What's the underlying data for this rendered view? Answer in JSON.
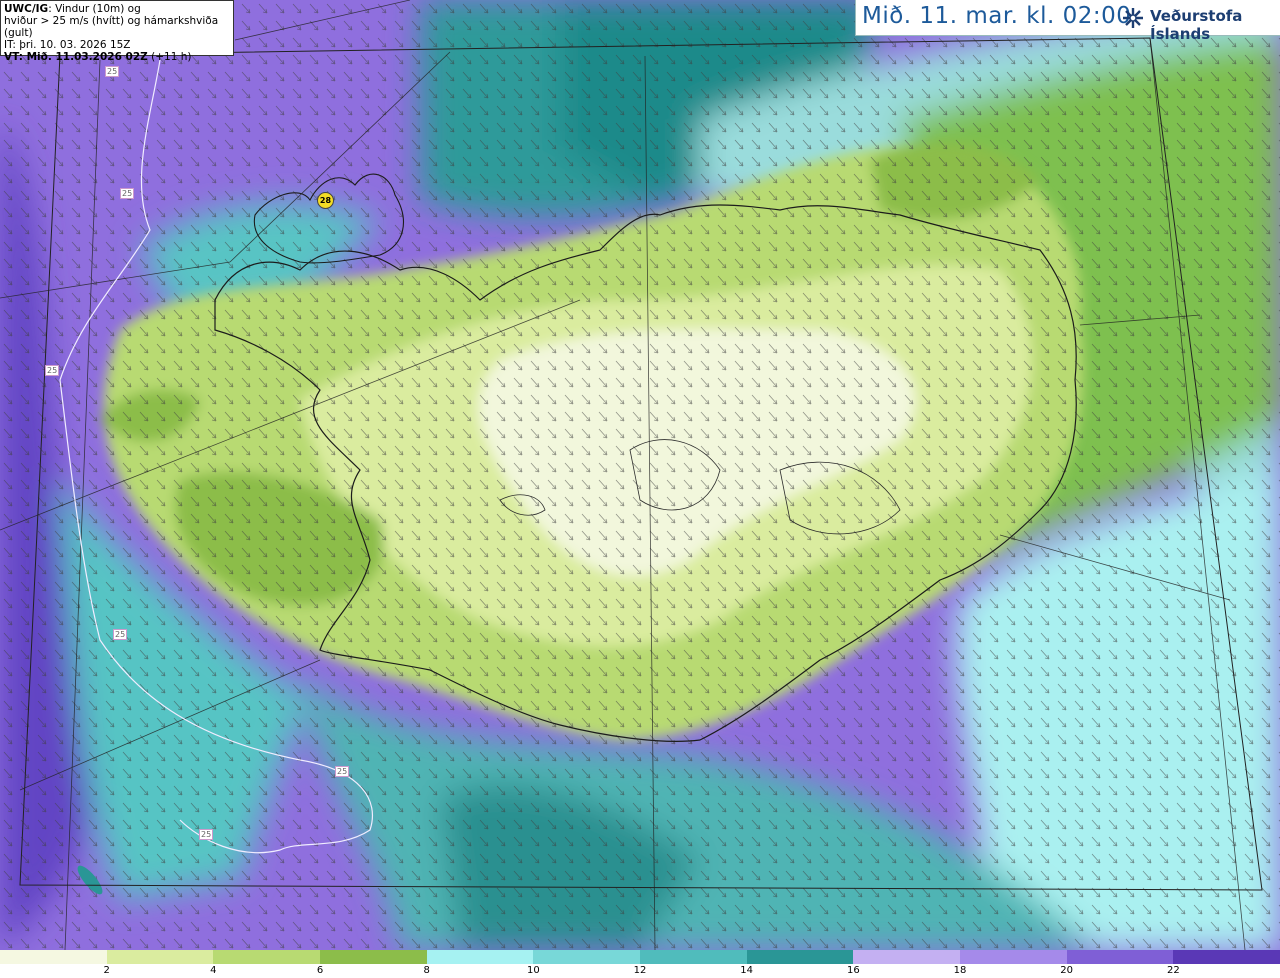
{
  "info": {
    "line1_bold": "UWC/IG",
    "line1_rest": ": Vindur (10m) og",
    "line2": "hviður > 25 m/s (hvítt) og hámarkshviða (gult)",
    "line3": "IT: þri. 10. 03. 2026 15Z",
    "line4_bold": "VT: Mið. 11.03.2026 02Z",
    "line4_rest": " (+11 h)"
  },
  "header": {
    "title": "Mið. 11. mar. kl. 02:00",
    "org": "Veðurstofa Íslands",
    "logo_icon": "vedurstofa-logo-icon"
  },
  "gust_contour_label": "25",
  "max_gust_label": "28",
  "legend": {
    "ticks": [
      "2",
      "4",
      "6",
      "8",
      "10",
      "12",
      "14",
      "16",
      "18",
      "20",
      "22"
    ],
    "colors": [
      "#f5f8e1",
      "#daec9f",
      "#b8da72",
      "#8cbd4a",
      "#a6f2f2",
      "#78d8d8",
      "#50bcbc",
      "#2a9696",
      "#c4b0f2",
      "#a58aea",
      "#7f5fd6",
      "#5a38b6"
    ]
  }
}
